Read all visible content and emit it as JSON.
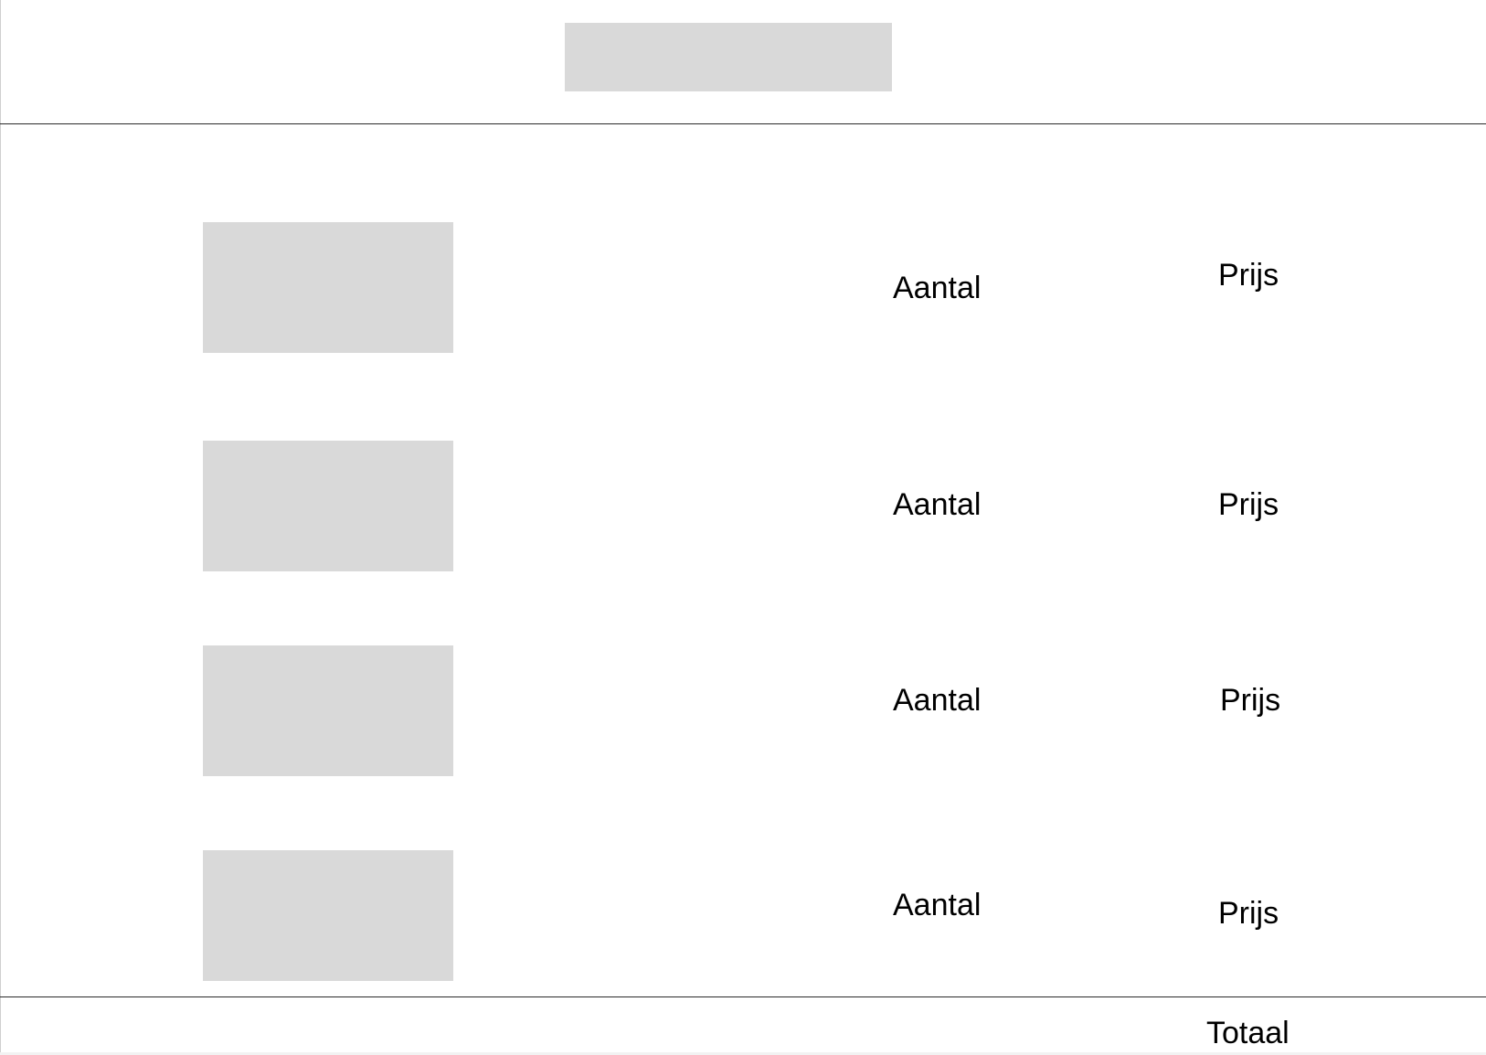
{
  "header": {
    "logo_icon": "image-placeholder-icon"
  },
  "cart": {
    "items": [
      {
        "thumbnail_icon": "image-placeholder-icon",
        "quantity_label": "Aantal",
        "price_label": "Prijs"
      },
      {
        "thumbnail_icon": "image-placeholder-icon",
        "quantity_label": "Aantal",
        "price_label": "Prijs"
      },
      {
        "thumbnail_icon": "image-placeholder-icon",
        "quantity_label": "Aantal",
        "price_label": "Prijs"
      },
      {
        "thumbnail_icon": "image-placeholder-icon",
        "quantity_label": "Aantal",
        "price_label": "Prijs"
      }
    ],
    "total_label": "Totaal"
  },
  "colors": {
    "placeholder_fill": "#d9d9d9",
    "divider": "#2a2a2a",
    "text": "#000000",
    "background": "#ffffff"
  }
}
